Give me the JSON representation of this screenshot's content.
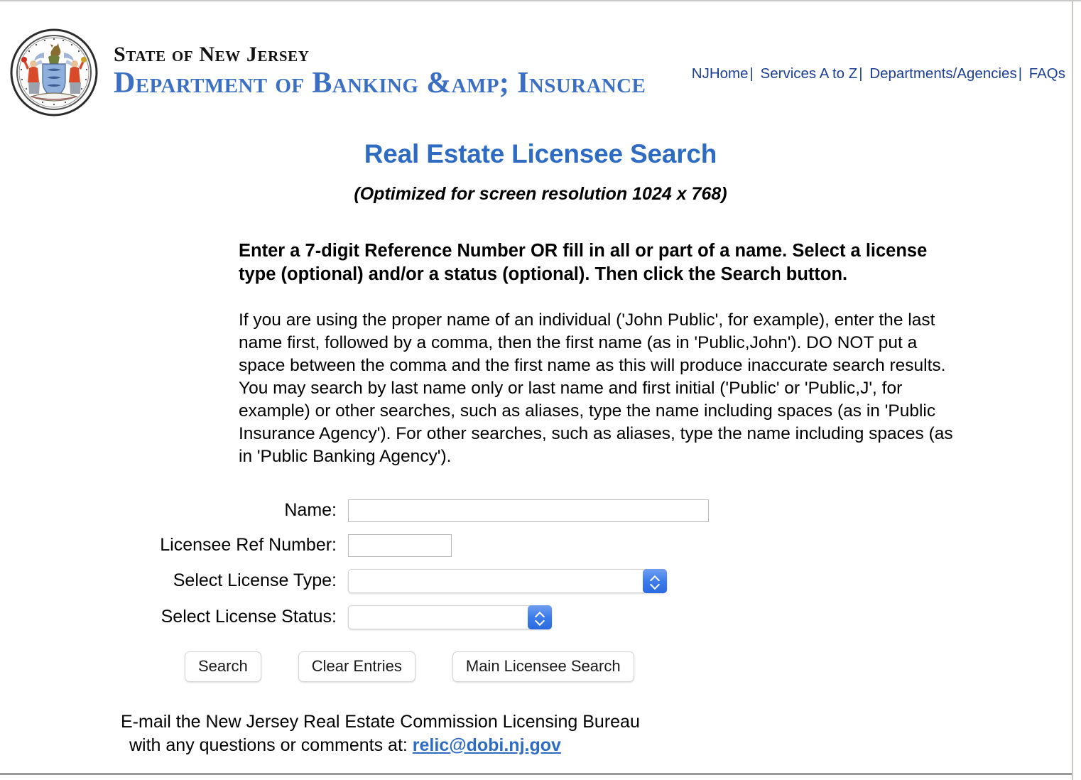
{
  "header": {
    "seal_alt": "Great Seal of the State of New Jersey",
    "state_line": "State of New Jersey",
    "department_line": "Department of Banking &amp; Insurance",
    "nav": [
      {
        "label": "NJHome"
      },
      {
        "label": "Services A to Z"
      },
      {
        "label": "Departments/Agencies"
      },
      {
        "label": "FAQs"
      }
    ],
    "nav_separator": "|"
  },
  "title": {
    "main": "Real Estate Licensee Search",
    "sub": "(Optimized for screen resolution 1024 x 768)"
  },
  "body_text": {
    "instructions": "Enter a 7-digit Reference Number OR fill in all or part of a name. Select a license type (optional) and/or a status (optional). Then click the Search button.",
    "explanation": "If you are using the proper name of an individual ('John Public', for example), enter the last name first, followed by a comma, then the first name (as in 'Public,John'). DO NOT put a space between the comma and the first name as this will produce inaccurate search results. You may search by last name only or last name and first initial ('Public' or 'Public,J', for example) or other searches, such as aliases, type the name including spaces (as in 'Public Insurance Agency'). For other searches, such as aliases, type the name including spaces (as in 'Public Banking Agency')."
  },
  "form": {
    "name": {
      "label": "Name:",
      "value": "",
      "placeholder": ""
    },
    "ref_number": {
      "label": "Licensee Ref Number:",
      "value": "",
      "placeholder": ""
    },
    "license_type": {
      "label": "Select License Type:",
      "selected": "",
      "options": [
        ""
      ]
    },
    "license_status": {
      "label": "Select License Status:",
      "selected": "",
      "options": [
        ""
      ]
    }
  },
  "buttons": {
    "search": "Search",
    "clear": "Clear Entries",
    "main_search": "Main Licensee Search"
  },
  "footer": {
    "line1": "E-mail the New Jersey Real Estate Commission Licensing Bureau",
    "line2_prefix": "with any questions or comments at: ",
    "email": "relic@dobi.nj.gov"
  },
  "colors": {
    "title_blue": "#2e6cc4",
    "dept_blue": "#3a6fc4",
    "nav_blue": "#1c3f94",
    "stepper_blue": "#3d7ceb"
  }
}
